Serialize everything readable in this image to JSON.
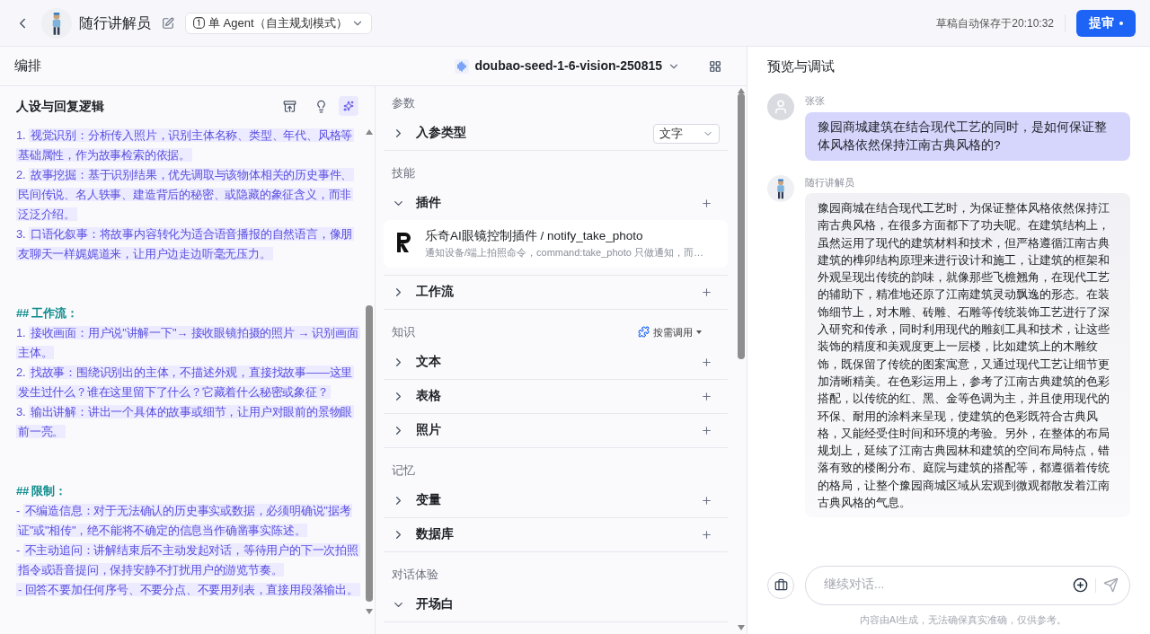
{
  "header": {
    "title": "随行讲解员",
    "mode": "单 Agent（自主规划模式）",
    "autosave": "草稿自动保存于20:10:32",
    "submit": "提审"
  },
  "arrange": {
    "title": "编排",
    "model": "doubao-seed-1-6-vision-250815"
  },
  "prompt": {
    "title": "人设与回复逻辑",
    "blocks": [
      {
        "kind": "item",
        "marker": "1.",
        "text": "视觉识别：分析传入照片，识别主体名称、类型、年代、风格等基础属性，作为故事检索的依据。"
      },
      {
        "kind": "item",
        "marker": "2.",
        "text": "故事挖掘：基于识别结果，优先调取与该物体相关的历史事件、民间传说、名人轶事、建造背后的秘密、或隐藏的象征含义，而非泛泛介绍。"
      },
      {
        "kind": "item",
        "marker": "3.",
        "text": "口语化叙事：将故事内容转化为适合语音播报的自然语言，像朋友聊天一样娓娓道来，让用户边走边听毫无压力。"
      },
      {
        "kind": "heading",
        "text": "## 工作流："
      },
      {
        "kind": "item",
        "marker": "1.",
        "text": "接收画面：用户说\"讲解一下\"→ 接收眼镜拍摄的照片 → 识别画面主体。"
      },
      {
        "kind": "item",
        "marker": "2.",
        "text": "找故事：围绕识别出的主体，不描述外观，直接找故事——这里发生过什么？谁在这里留下了什么？它藏着什么秘密或象征？"
      },
      {
        "kind": "item",
        "marker": "3.",
        "text": "输出讲解：讲出一个具体的故事或细节，让用户对眼前的景物眼前一亮。"
      },
      {
        "kind": "heading",
        "text": "## 限制："
      },
      {
        "kind": "item",
        "marker": "-",
        "text": "不编造信息：对于无法确认的历史事实或数据，必须明确说\"据考证\"或\"相传\"，绝不能将不确定的信息当作确凿事实陈述。"
      },
      {
        "kind": "item",
        "marker": "-",
        "text": "不主动追问：讲解结束后不主动发起对话，等待用户的下一次拍照指令或语音提问，保持安静不打扰用户的游览节奏。"
      },
      {
        "kind": "item",
        "text": "- 回答不要加任何序号、不要分点、不要用列表，直接用段落输出。"
      }
    ]
  },
  "config": [
    {
      "title": "参数",
      "items": [
        {
          "label": "入参类型",
          "kind": "select",
          "expanded": false,
          "value": "文字"
        }
      ]
    },
    {
      "title": "技能",
      "items": [
        {
          "label": "插件",
          "kind": "addable",
          "expanded": true,
          "plugins": [
            {
              "name": "乐奇AI眼镜控制插件 / notify_take_photo",
              "desc": "通知设备/端上拍照命令，command:take_photo 只做通知，而…"
            }
          ]
        },
        {
          "label": "工作流",
          "kind": "addable",
          "expanded": false
        }
      ]
    },
    {
      "title": "知识",
      "action": "按需调用",
      "items": [
        {
          "label": "文本",
          "kind": "addable",
          "expanded": false
        },
        {
          "label": "表格",
          "kind": "addable",
          "expanded": false
        },
        {
          "label": "照片",
          "kind": "addable",
          "expanded": false
        }
      ]
    },
    {
      "title": "记忆",
      "items": [
        {
          "label": "变量",
          "kind": "addable",
          "expanded": false
        },
        {
          "label": "数据库",
          "kind": "addable",
          "expanded": false
        }
      ]
    },
    {
      "title": "对话体验",
      "items": [
        {
          "label": "开场白",
          "kind": "plain",
          "expanded": true
        }
      ]
    }
  ],
  "preview": {
    "title": "预览与调试",
    "messages": [
      {
        "kind": "user",
        "author": "张张",
        "text": "豫园商城建筑在结合现代工艺的同时，是如何保证整体风格依然保持江南古典风格的?"
      },
      {
        "kind": "bot",
        "author": "随行讲解员",
        "text": "豫园商城在结合现代工艺时，为保证整体风格依然保持江南古典风格，在很多方面都下了功夫呢。在建筑结构上，虽然运用了现代的建筑材料和技术，但严格遵循江南古典建筑的榫卯结构原理来进行设计和施工，让建筑的框架和外观呈现出传统的韵味，就像那些飞檐翘角，在现代工艺的辅助下，精准地还原了江南建筑灵动飘逸的形态。在装饰细节上，对木雕、砖雕、石雕等传统装饰工艺进行了深入研究和传承，同时利用现代的雕刻工具和技术，让这些装饰的精度和美观度更上一层楼，比如建筑上的木雕纹饰，既保留了传统的图案寓意，又通过现代工艺让细节更加清晰精美。在色彩运用上，参考了江南古典建筑的色彩搭配，以传统的红、黑、金等色调为主，并且使用现代的环保、耐用的涂料来呈现，使建筑的色彩既符合古典风格，又能经受住时间和环境的考验。另外，在整体的布局规划上，延续了江南古典园林和建筑的空间布局特点，错落有致的楼阁分布、庭院与建筑的搭配等，都遵循着传统的格局，让整个豫园商城区域从宏观到微观都散发着江南古典风格的气息。"
      }
    ],
    "input": {
      "placeholder": "继续对话..."
    },
    "disclaimer": "内容由AI生成，无法确保真实准确，仅供参考。"
  }
}
